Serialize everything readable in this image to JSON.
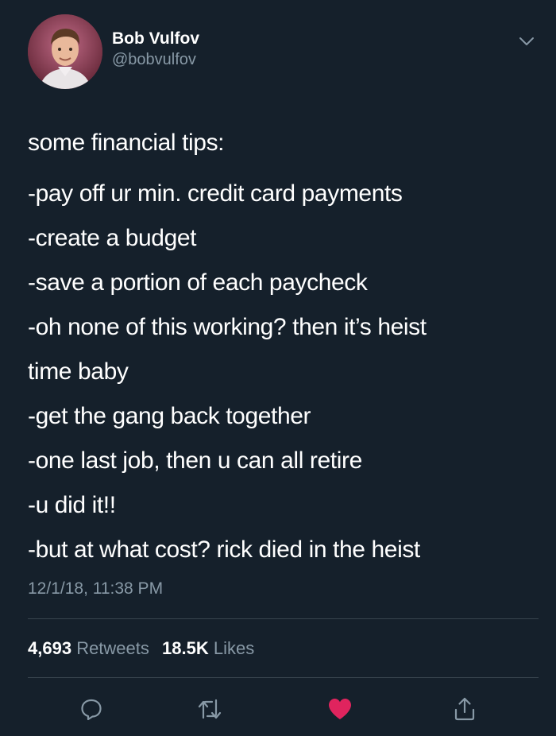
{
  "user": {
    "display_name": "Bob Vulfov",
    "handle": "@bobvulfov",
    "avatar_icon": "profile-photo"
  },
  "tweet": {
    "intro": "some financial tips:",
    "lines": [
      "-pay off ur min. credit card payments",
      "-create a budget",
      "-save a portion of each paycheck",
      "-oh none of this working? then it’s heist",
      "time baby",
      "-get the gang back together",
      "-one last job, then u can all retire",
      "-u did it!!",
      "-but at what cost? rick died in the heist"
    ],
    "timestamp": "12/1/18, 11:38 PM"
  },
  "stats": {
    "retweets_count": "4,693",
    "retweets_label": "Retweets",
    "likes_count": "18.5K",
    "likes_label": "Likes"
  },
  "actions": [
    {
      "name": "reply",
      "icon": "reply-icon"
    },
    {
      "name": "retweet",
      "icon": "retweet-icon"
    },
    {
      "name": "like",
      "icon": "heart-icon",
      "active": true
    },
    {
      "name": "share",
      "icon": "share-icon"
    }
  ],
  "colors": {
    "background": "#15202b",
    "secondary_text": "#8899a6",
    "divider": "#38444d",
    "like_active": "#e0245e"
  }
}
